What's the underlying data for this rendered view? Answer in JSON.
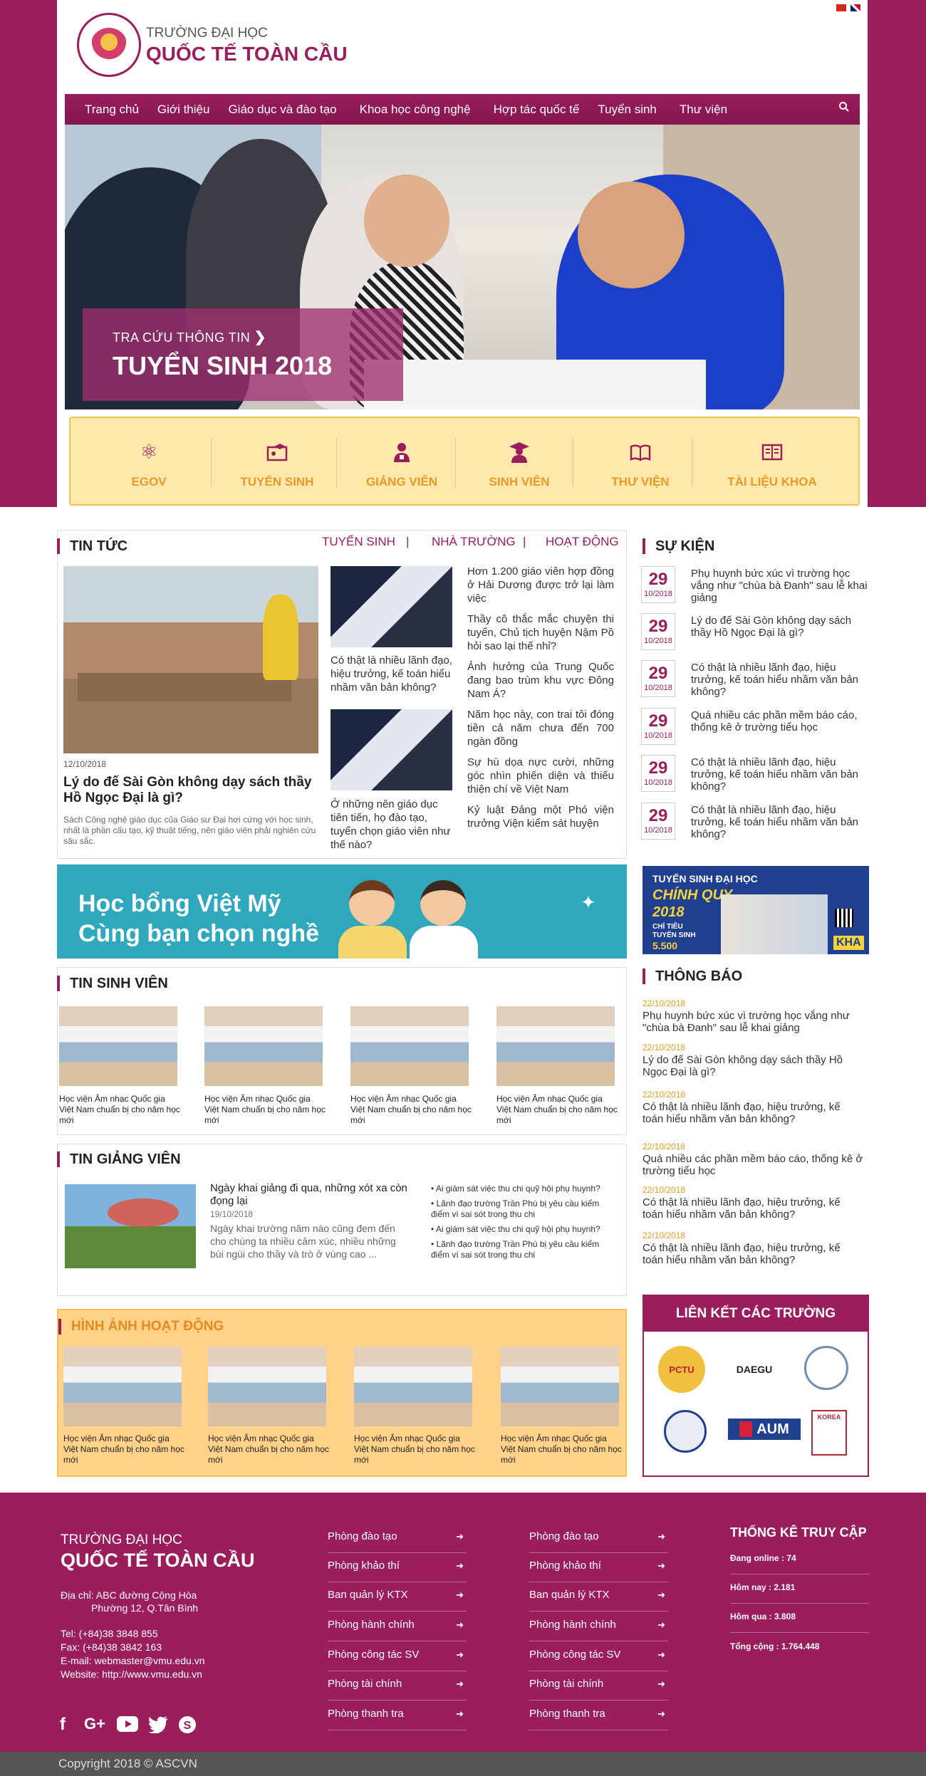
{
  "colors": {
    "brand": "#9a1d5c",
    "accent": "#e79b25",
    "quick_bg": "#ffe8ac",
    "gallery_bg": "#ffd28a"
  },
  "header": {
    "school_sub": "TRƯỜNG ĐẠI HỌC",
    "school_main": "QUỐC TẾ TOÀN CẦU"
  },
  "nav": {
    "items": [
      "Trang chủ",
      "Giới thiệu",
      "Giáo dục và đào tạo",
      "Khoa học công nghệ",
      "Hợp tác quốc tế",
      "Tuyển sinh",
      "Thư viện"
    ],
    "search_icon": "search-icon"
  },
  "hero": {
    "subtitle": "TRA CỨU THÔNG TIN",
    "title": "TUYỂN SINH 2018"
  },
  "quick_links": [
    {
      "label": "EGOV",
      "icon": "atom-icon"
    },
    {
      "label": "TUYỂN SINH",
      "icon": "id-card-icon"
    },
    {
      "label": "GIẢNG VIÊN",
      "icon": "teacher-icon"
    },
    {
      "label": "SINH VIÊN",
      "icon": "graduate-icon"
    },
    {
      "label": "THƯ VIỆN",
      "icon": "book-icon"
    },
    {
      "label": "TÀI LIỆU KHOA",
      "icon": "documents-icon"
    }
  ],
  "news": {
    "heading": "TIN TỨC",
    "tabs": [
      "TUYỂN SINH",
      "|",
      "NHÀ TRƯỜNG",
      "|",
      "HOẠT ĐỘNG"
    ],
    "featured": {
      "date": "12/10/2018",
      "title": "Lý do đế Sài Gòn không dạy sách thầy Hồ Ngọc Đại là gì?",
      "summary": "Sách Công nghệ giáo dục của Giáo sư Đại hơi cứng với học sinh, nhất là phần cấu tạo, kỹ thuật tiếng, nên giáo viên phải nghiên cứu sâu sắc."
    },
    "mid": [
      {
        "title": "Có thật là nhiều lãnh đạo, hiệu trưởng, kế toán hiểu nhầm văn bản không?"
      },
      {
        "title": "Ở những nên giáo dục tiên tiến, họ đào tạo, tuyển chọn giáo viên như thế nào?"
      }
    ],
    "list": [
      "Hơn 1.200 giáo viên hợp đồng ở Hải Dương được trở lại làm việc",
      "Thầy cô thắc mắc chuyện thi tuyển, Chủ tịch huyện Nậm Pồ hỏi sao lại thế nhỉ?",
      "Ảnh hưởng của Trung Quốc đang bao trùm khu vực Đông Nam Á?",
      "Năm học này, con trai tôi đóng tiền cả năm chưa đến 700 ngàn đồng",
      "Sự hù dọa nực cười, những góc nhìn phiến diện và thiếu thiện chí về Việt Nam",
      "Kỷ luật Đảng một Phó viện trưởng Viện kiểm sát huyện"
    ]
  },
  "events": {
    "heading": "SỰ KIỆN",
    "items": [
      {
        "day": "29",
        "month": "10/2018",
        "title": "Phụ huynh bức xúc vì trường học vắng như \"chùa bà Đanh\" sau lễ khai giảng"
      },
      {
        "day": "29",
        "month": "10/2018",
        "title": "Lý do đế Sài Gòn không dạy sách thầy Hồ Ngọc Đại là gì?"
      },
      {
        "day": "29",
        "month": "10/2018",
        "title": "Có thật là nhiều lãnh đạo, hiệu trưởng, kế toán hiểu nhầm văn bản không?"
      },
      {
        "day": "29",
        "month": "10/2018",
        "title": "Quá nhiều các phần mềm báo cáo, thống kê ở trường tiểu học"
      },
      {
        "day": "29",
        "month": "10/2018",
        "title": "Có thật là nhiều lãnh đạo, hiệu trưởng, kế toán hiểu nhầm văn bản không?"
      },
      {
        "day": "29",
        "month": "10/2018",
        "title": "Có thật là nhiều lãnh đạo, hiệu trưởng, kế toán hiểu nhầm văn bản không?"
      }
    ]
  },
  "banner_left": {
    "line1": "Học bổng Việt Mỹ",
    "line2": "Cùng bạn chọn nghề"
  },
  "banner_right": {
    "line1": "TUYỂN SINH ĐẠI HỌC",
    "line2": "CHÍNH QUY",
    "line3": "2018",
    "line4": "CHỈ TIÊU",
    "line5": "TUYỂN SINH",
    "line6": "5.500",
    "tag": "KHA"
  },
  "student_news": {
    "heading": "TIN SINH VIÊN",
    "caption": "Học viện Âm nhạc Quốc gia Việt Nam chuẩn bị cho năm học mới"
  },
  "lecturer_news": {
    "heading": "TIN GIẢNG VIÊN",
    "title": "Ngày khai giảng đi qua, những xót xa còn đọng lại",
    "date": "19/10/2018",
    "summary": "Ngày khai trường năm nào cũng đem đến cho chúng ta nhiều cảm xúc, nhiều những bùi ngùi cho thầy và trò ở vùng cao ...",
    "bullets": [
      "Ai giám sát việc thu chi quỹ hội phụ huynh?",
      "Lãnh đạo trường Trần Phú bị yêu cầu kiểm điểm vì sai sót trong thu chi",
      "Ai giám sát việc thu chi quỹ hội phụ huynh?",
      "Lãnh đạo trường Trần Phú bị yêu cầu kiểm điểm vì sai sót trong thu chi"
    ]
  },
  "notices": {
    "heading": "THÔNG BÁO",
    "items": [
      {
        "date": "22/10/2018",
        "title": "Phụ huynh bức xúc vì trường học vắng như \"chùa bà Đanh\" sau lễ khai giảng"
      },
      {
        "date": "22/10/2018",
        "title": "Lý do đế Sài Gòn không dạy sách thầy Hồ Ngọc Đại là gì?"
      },
      {
        "date": "22/10/2018",
        "title": "Có thật là nhiều lãnh đạo, hiệu trưởng, kế toán hiểu nhầm văn bản không?"
      },
      {
        "date": "22/10/2018",
        "title": "Quá nhiều các phần mềm báo cáo, thống kê ở trường tiểu học"
      },
      {
        "date": "22/10/2018",
        "title": "Có thật là nhiều lãnh đạo, hiệu trưởng, kế toán hiểu nhầm văn bản không?"
      },
      {
        "date": "22/10/2018",
        "title": "Có thật là nhiều lãnh đạo, hiệu trưởng, kế toán hiểu nhầm văn bản không?"
      }
    ]
  },
  "gallery": {
    "heading": "HÌNH ẢNH HOẠT ĐỘNG",
    "caption": "Học viện Âm nhạc Quốc gia Việt Nam chuẩn bị cho năm học mới"
  },
  "partner_links": {
    "heading": "LIÊN KẾT CÁC TRƯỜNG",
    "logos": [
      "PCTU",
      "DAEGU",
      "",
      "",
      "AUM",
      "KOREA"
    ]
  },
  "footer": {
    "sub": "TRƯỜNG ĐẠI HỌC",
    "main": "QUỐC TẾ TOÀN CẦU",
    "address1": "Địa chỉ: ABC đường Cộng Hòa",
    "address2": "Phường 12, Q.Tân Bình",
    "tel": "Tel: (+84)38 3848 855",
    "fax": "Fax: (+84)38 3842 163",
    "email": "E-mail: webmaster@vmu.edu.vn",
    "website": "Website: http://www.vmu.edu.vn",
    "links": [
      "Phòng đào tạo",
      "Phòng khảo thí",
      "Ban quản lý KTX",
      "Phòng hành chính",
      "Phòng công tác SV",
      "Phòng tài chính",
      "Phòng thanh tra"
    ],
    "stats_heading": "THỐNG KÊ TRUY CẬP",
    "stats": [
      "Đang online : 74",
      "Hôm nay : 2.181",
      "Hôm qua : 3.808",
      "Tổng cộng : 1.764.448"
    ],
    "social": [
      "facebook-icon",
      "google-plus-icon",
      "youtube-icon",
      "twitter-icon",
      "skype-icon"
    ],
    "copyright": "Copyright  2018 © ASCVN"
  }
}
